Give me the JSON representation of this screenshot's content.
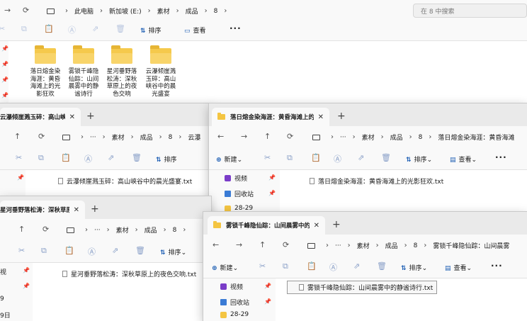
{
  "common": {
    "back": "←",
    "forward": "→",
    "up": "↑",
    "refresh": "⟳",
    "chevron": "›",
    "ellipsis": "···",
    "close": "✕",
    "plus": "+",
    "more": "···",
    "dropdown": "⌄",
    "cut": "✂",
    "copy": "⧉",
    "paste": "📋",
    "rename": "Ⓐ",
    "share": "⇗",
    "delete": "🗑"
  },
  "bg_window": {
    "breadcrumb": [
      "此电脑",
      "新加坡 (E:)",
      "素材",
      "成品",
      "8"
    ],
    "search_placeholder": "在 8 中搜索",
    "sort_label": "排序",
    "view_label": "查看",
    "folders": [
      "落日熔金染海涯：黄昏海滩上的光影狂欢",
      "雾锁千峰隐仙踪：山间晨雾中的静谧诗行",
      "星河垂野落松涛：深秋草原上的夜色交响",
      "云瀑倾崖溅玉碎：高山峡谷中的晨光盛宴"
    ]
  },
  "win_a": {
    "tab_title": "云瀑倾崖溅玉碎：高山峡谷中的",
    "breadcrumb": [
      "素材",
      "成品",
      "8",
      "云瀑"
    ],
    "sort_label": "排序",
    "file": "云瀑倾崖溅玉碎：高山峡谷中的晨光盛宴.txt"
  },
  "win_b": {
    "tab_title": "落日熔金染海涯：黄昏海滩上的",
    "breadcrumb": [
      "素材",
      "成品",
      "8",
      "落日熔金染海涯：黄昏海滩"
    ],
    "new_label": "新建",
    "sort_label": "排序",
    "view_label": "查看",
    "nav_items": [
      "视频",
      "回收站",
      "28-29"
    ],
    "file": "落日熔金染海涯：黄昏海滩上的光影狂欢.txt"
  },
  "win_c": {
    "tab_title": "星河垂野落松涛：深秋草原上的",
    "breadcrumb": [
      "素材",
      "成品",
      "8"
    ],
    "sort_label": "排序",
    "nav_items": [
      "视",
      "9",
      "9日"
    ],
    "file": "星河垂野落松涛：深秋草原上的夜色交响.txt"
  },
  "win_d": {
    "tab_title": "雾锁千峰隐仙踪：山间晨雾中的",
    "breadcrumb": [
      "素材",
      "成品",
      "8",
      "雾锁千峰隐仙踪：山间晨雾"
    ],
    "new_label": "新建",
    "sort_label": "排序",
    "view_label": "查看",
    "nav_items": [
      "视频",
      "回收站",
      "28-29"
    ],
    "file": "雾锁千峰隐仙踪：山间晨雾中的静谧诗行.txt"
  },
  "colors": {
    "folder": "#f5c94c",
    "accent": "#1f5fb4",
    "video": "#7a3cc8",
    "recycle": "#3a7bd5",
    "folder_small": "#f4c542"
  }
}
